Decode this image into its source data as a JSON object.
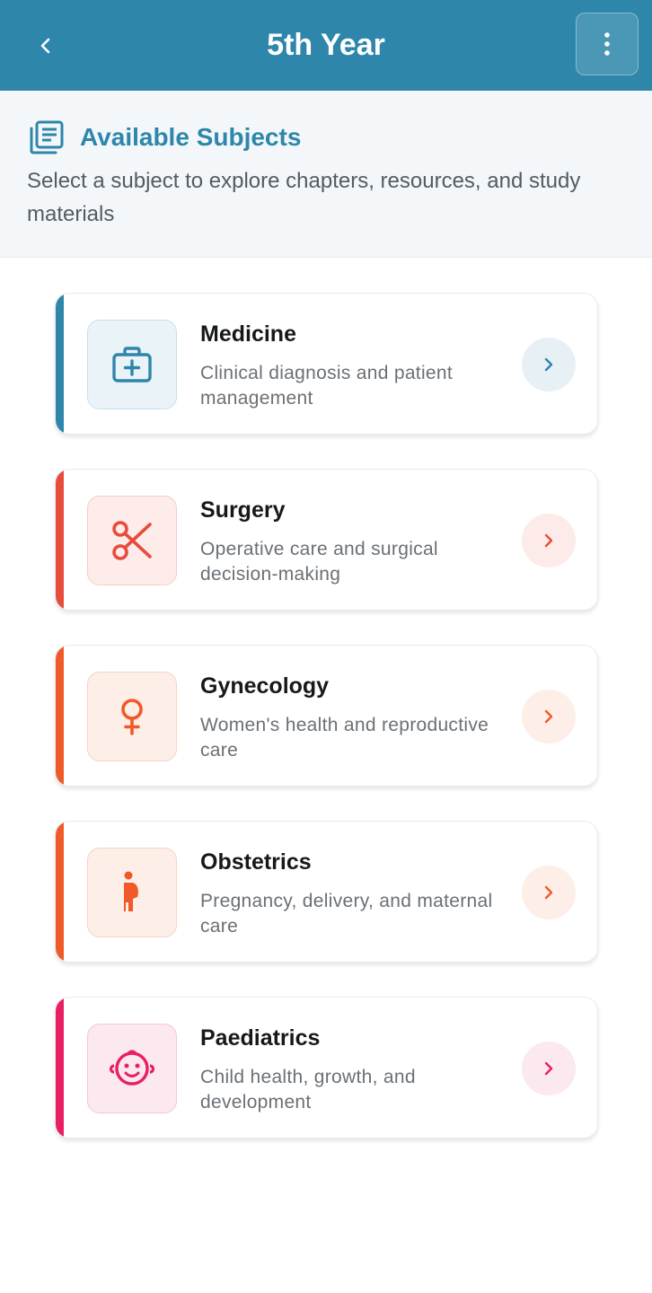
{
  "appbar": {
    "title": "5th Year",
    "background": "#2e86ab",
    "back_icon": "chevron-left-icon",
    "menu_icon": "more-vertical-icon"
  },
  "intro": {
    "icon": "library-books-icon",
    "title": "Available Subjects",
    "subtitle": "Select a subject to explore chapters, resources, and study materials"
  },
  "subjects": [
    {
      "title": "Medicine",
      "description": "Clinical diagnosis and patient management",
      "icon": "medical-kit-icon",
      "accent": "#2e86ab",
      "icon_bg": "#eaf3f8",
      "arrow_bg": "#e6f0f5"
    },
    {
      "title": "Surgery",
      "description": "Operative care and surgical decision-making",
      "icon": "scissors-icon",
      "accent": "#e74c3c",
      "icon_bg": "#fdecea",
      "arrow_bg": "#fcebe8"
    },
    {
      "title": "Gynecology",
      "description": "Women's health and reproductive care",
      "icon": "female-symbol-icon",
      "accent": "#f05a28",
      "icon_bg": "#fdeee8",
      "arrow_bg": "#fdeee7"
    },
    {
      "title": "Obstetrics",
      "description": "Pregnancy, delivery, and maternal care",
      "icon": "pregnant-woman-icon",
      "accent": "#f05a28",
      "icon_bg": "#fdeee8",
      "arrow_bg": "#fdeee7"
    },
    {
      "title": "Paediatrics",
      "description": "Child health, growth, and development",
      "icon": "baby-face-icon",
      "accent": "#e91e63",
      "icon_bg": "#fce8ef",
      "arrow_bg": "#fce8ef"
    }
  ]
}
